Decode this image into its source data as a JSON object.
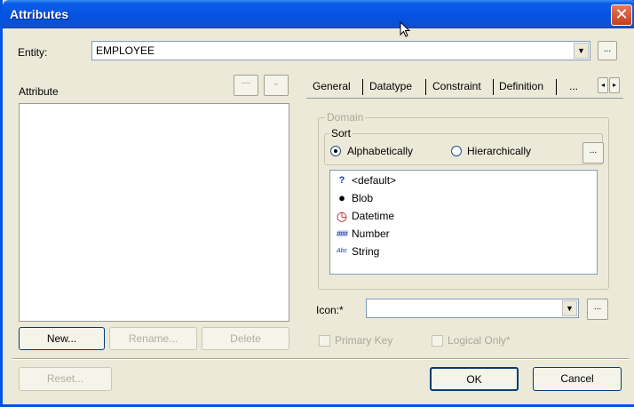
{
  "window": {
    "title": "Attributes"
  },
  "entity": {
    "label": "Entity:",
    "value": "EMPLOYEE",
    "ellipsis": "..."
  },
  "attribute": {
    "label": "Attribute"
  },
  "tabs": [
    "General",
    "Datatype",
    "Constraint",
    "Definition",
    "..."
  ],
  "domain": {
    "legend": "Domain",
    "sort_legend": "Sort",
    "sort_alpha": "Alphabetically",
    "sort_hier": "Hierarchically",
    "ellipsis": "...",
    "items": [
      {
        "icon": "question-icon",
        "glyph": "?",
        "label": "<default>"
      },
      {
        "icon": "blob-icon",
        "glyph": "●",
        "label": "Blob"
      },
      {
        "icon": "clock-icon",
        "glyph": "◷",
        "label": "Datetime"
      },
      {
        "icon": "number-icon",
        "glyph": "###",
        "label": "Number"
      },
      {
        "icon": "string-icon",
        "glyph": "Abc",
        "label": "String"
      }
    ]
  },
  "icon": {
    "label": "Icon:*",
    "value": "",
    "ellipsis": "..."
  },
  "checkboxes": {
    "primary_key": "Primary Key",
    "logical_only": "Logical Only*"
  },
  "buttons": {
    "new": "New...",
    "rename": "Rename...",
    "delete": "Delete",
    "reset": "Reset...",
    "ok": "OK",
    "cancel": "Cancel"
  },
  "colors": {
    "titlebar": "#0553e2",
    "close": "#c4401e",
    "face": "#ece9d8"
  }
}
